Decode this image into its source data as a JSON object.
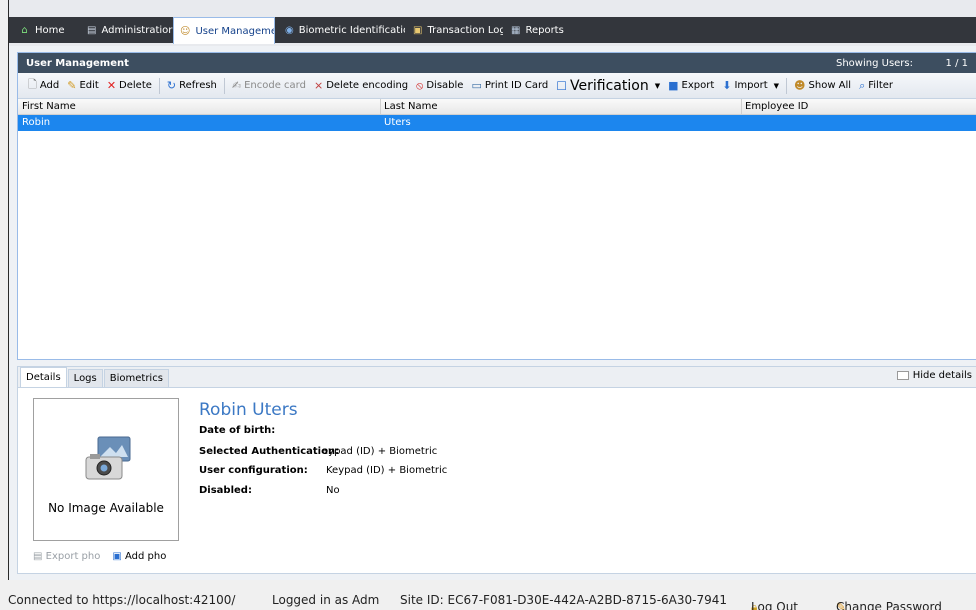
{
  "tabs": [
    {
      "label": "Home",
      "icon": "home-icon"
    },
    {
      "label": "Administratior",
      "icon": "admin-icon"
    },
    {
      "label": "User Managemen",
      "icon": "users-icon"
    },
    {
      "label": "Biometric Identificatic",
      "icon": "fingerprint-icon"
    },
    {
      "label": "Transaction Log",
      "icon": "log-icon"
    },
    {
      "label": "Reports",
      "icon": "reports-icon"
    }
  ],
  "panel": {
    "title": "User Management",
    "showing_label": "Showing Users:",
    "showing_count": "1 / 1"
  },
  "toolbar": {
    "add": "Add",
    "edit": "Edit",
    "delete": "Delete",
    "refresh": "Refresh",
    "encode_card": "Encode card",
    "delete_encoding": "Delete encoding",
    "disable": "Disable",
    "print_id": "Print ID Card",
    "verification": "Verification",
    "export": "Export",
    "import": "Import",
    "show_all": "Show All",
    "filter": "Filter"
  },
  "grid": {
    "columns": [
      "First Name",
      "Last Name",
      "Employee ID"
    ],
    "rows": [
      {
        "first": "Robin",
        "last": "Uters",
        "employee_id": ""
      }
    ]
  },
  "details": {
    "tabs": [
      "Details",
      "Logs",
      "Biometrics"
    ],
    "hide_label": "Hide details",
    "no_image": "No Image Available",
    "export_photo": "Export pho",
    "add_photo": "Add pho",
    "name": "Robin Uters",
    "fields": {
      "dob_label": "Date of birth:",
      "dob_value": "",
      "auth_label": "Selected Authentication:",
      "auth_value": "eypad (ID) + Biometric",
      "config_label": "User configuration:",
      "config_value": "Keypad (ID) + Biometric",
      "disabled_label": "Disabled:",
      "disabled_value": "No"
    }
  },
  "status": {
    "connected": "Connected to https://localhost:42100/",
    "logged_in": "Logged in as Adm",
    "site_id": "Site ID: EC67-F081-D30E-442A-A2BD-8715-6A30-7941",
    "logout": "Log Out",
    "change_password": "Change Password"
  },
  "colors": {
    "selected_row": "#1c86ee",
    "header_bar": "#3d4e60",
    "name_accent": "#3b78c4"
  }
}
